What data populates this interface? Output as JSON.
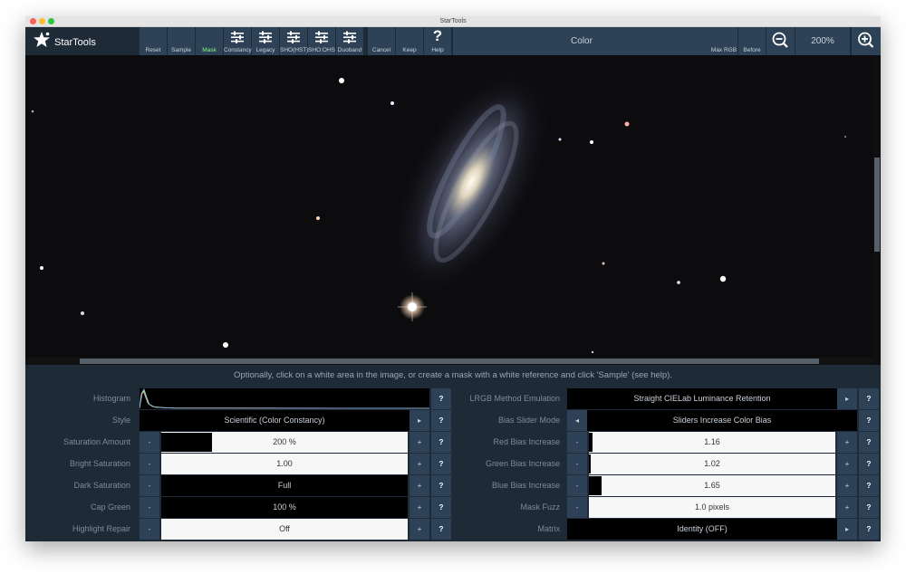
{
  "app": {
    "title": "StarTools",
    "logo_text": "StarTools"
  },
  "toolbar": {
    "buttons": [
      {
        "label": "Reset"
      },
      {
        "label": "Sample"
      },
      {
        "label": "Mask"
      },
      {
        "label": "Constancy"
      },
      {
        "label": "Legacy"
      },
      {
        "label": "SHO(HST)"
      },
      {
        "label": "SHO:OHS"
      },
      {
        "label": "Duoband"
      },
      {
        "label": "Cancel"
      },
      {
        "label": "Keep"
      },
      {
        "label": "Help"
      }
    ],
    "module_title": "Color",
    "right_buttons": [
      {
        "label": "Max RGB"
      },
      {
        "label": "Before"
      }
    ],
    "zoom_level": "200%",
    "accent_mask_color": "#7cff7c"
  },
  "hint": "Optionally, click on a white area in the image, or create a mask with a white reference and click 'Sample' (see help).",
  "left_params": [
    {
      "label": "Histogram"
    },
    {
      "label": "Style",
      "value": "Scientific (Color Constancy)"
    },
    {
      "label": "Saturation Amount",
      "value": "200 %",
      "level": 0.2
    },
    {
      "label": "Bright Saturation",
      "value": "1.00"
    },
    {
      "label": "Dark Saturation",
      "value": "Full"
    },
    {
      "label": "Cap Green",
      "value": "100 %"
    },
    {
      "label": "Highlight Repair",
      "value": "Off"
    }
  ],
  "right_params": [
    {
      "label": "LRGB Method Emulation",
      "value": "Straight CIELab Luminance Retention"
    },
    {
      "label": "Bias Slider Mode",
      "value": "Sliders Increase Color Bias"
    },
    {
      "label": "Red Bias Increase",
      "value": "1.16",
      "level": 0.016
    },
    {
      "label": "Green Bias Increase",
      "value": "1.02",
      "level": 0.006
    },
    {
      "label": "Blue Bias Increase",
      "value": "1.65",
      "level": 0.05
    },
    {
      "label": "Mask Fuzz",
      "value": "1.0 pixels"
    },
    {
      "label": "Matrix",
      "value": "Identity (OFF)"
    }
  ],
  "controls": {
    "minus": "-",
    "plus": "+",
    "help": "?",
    "arrow_right": "▸",
    "arrow_left": "◂"
  }
}
